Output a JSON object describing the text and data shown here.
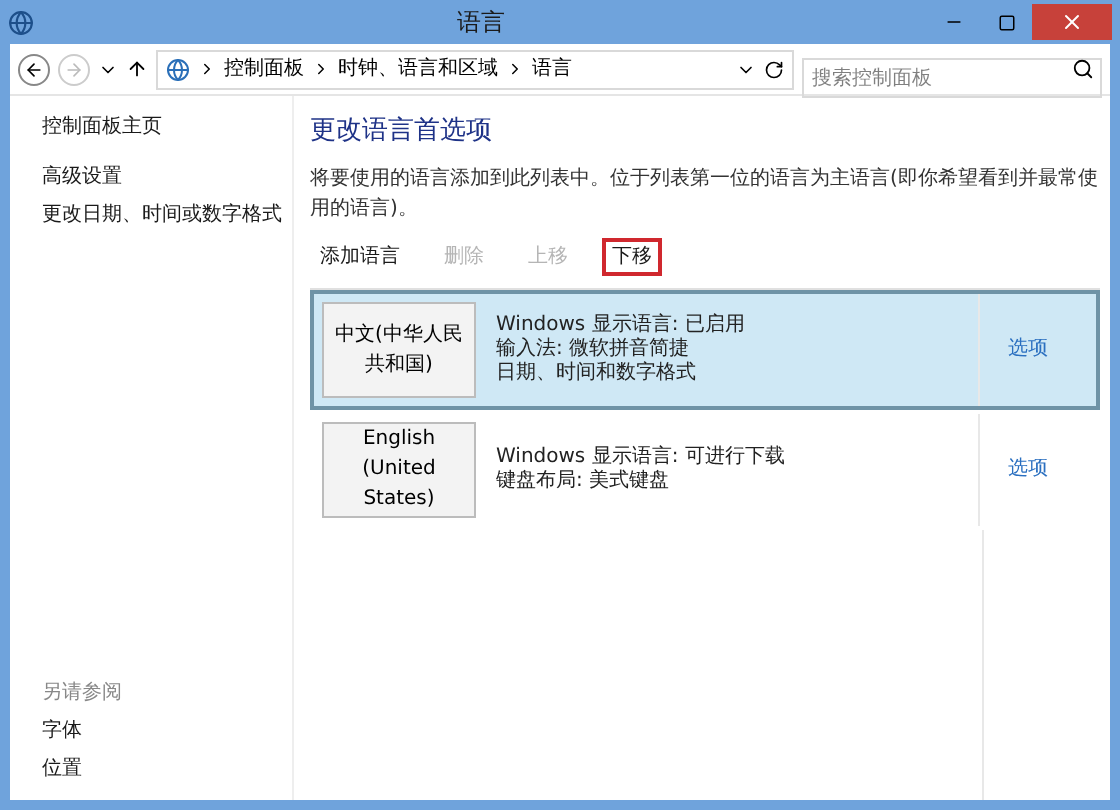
{
  "window": {
    "title": "语言"
  },
  "address_bar": {
    "path": [
      "控制面板",
      "时钟、语言和区域",
      "语言"
    ],
    "search": {
      "placeholder": "搜索控制面板"
    }
  },
  "sidebar": {
    "home": "控制面板主页",
    "items": [
      "高级设置",
      "更改日期、时间或数字格式"
    ],
    "see_also": {
      "title": "另请参阅",
      "items": [
        "字体",
        "位置"
      ]
    }
  },
  "main": {
    "heading": "更改语言首选项",
    "description": "将要使用的语言添加到此列表中。位于列表第一位的语言为主语言(即你希望看到并最常使用的语言)。",
    "toolbar": [
      {
        "label": "添加语言",
        "disabled": false,
        "highlighted": false
      },
      {
        "label": "删除",
        "disabled": true,
        "highlighted": false
      },
      {
        "label": "上移",
        "disabled": true,
        "highlighted": false
      },
      {
        "label": "下移",
        "disabled": false,
        "highlighted": true
      }
    ],
    "languages": [
      {
        "name": "中文(中华人民共和国)",
        "details": [
          "Windows 显示语言: 已启用",
          "输入法: 微软拼音简捷",
          "日期、时间和数字格式"
        ],
        "options": "选项",
        "selected": true
      },
      {
        "name": "English (United States)",
        "details": [
          "Windows 显示语言: 可进行下载",
          "键盘布局: 美式键盘"
        ],
        "options": "选项",
        "selected": false
      }
    ]
  }
}
